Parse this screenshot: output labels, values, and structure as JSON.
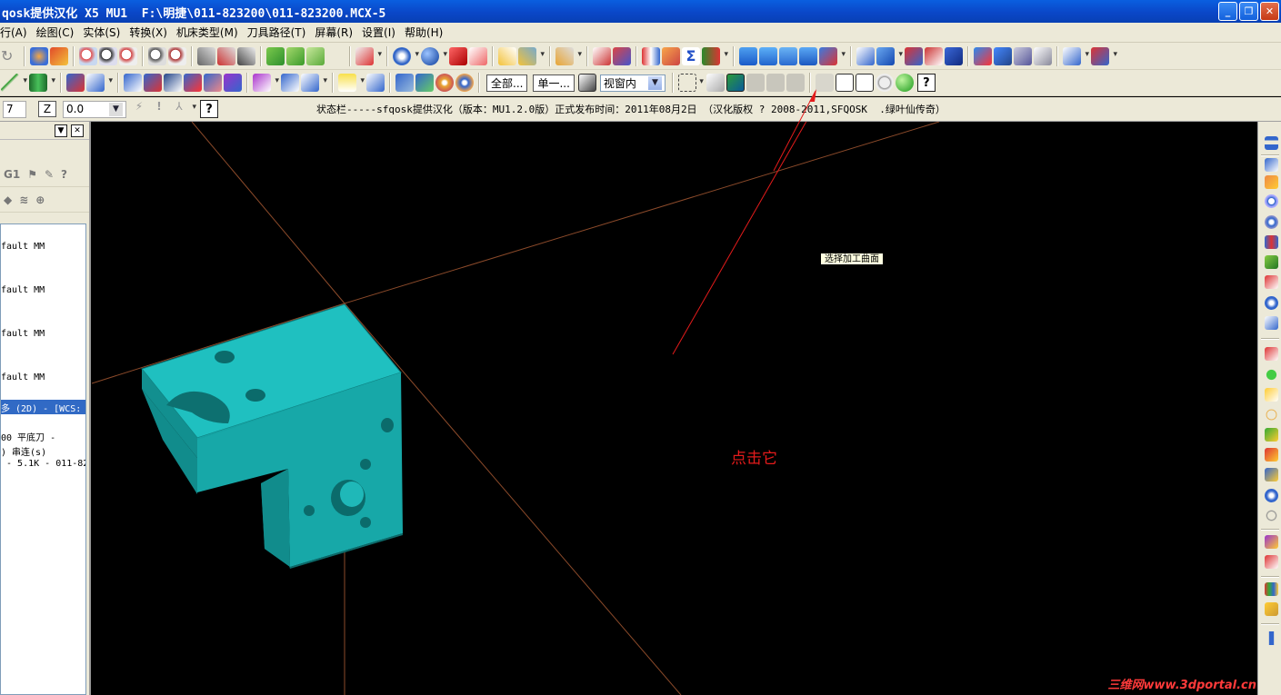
{
  "window": {
    "title": "qosk提供汉化 X5 MU1  F:\\明捷\\011-823200\\011-823200.MCX-5",
    "min": "_",
    "max": "❐",
    "close": "✕"
  },
  "menu": [
    "行(A)",
    "绘图(C)",
    "实体(S)",
    "转换(X)",
    "机床类型(M)",
    "刀具路径(T)",
    "屏幕(R)",
    "设置(I)",
    "帮助(H)"
  ],
  "toolbar2": {
    "all_button": "全部...",
    "single_button": "单一...",
    "view_combo": "视窗内"
  },
  "toolbar3": {
    "left_combo": "7",
    "z_label": "Z",
    "z_value": "0.0",
    "help": "?",
    "status": "状态栏-----sfqosk提供汉化（版本：MU1.2.0版）正式发布时间：2011年08月2日 （汉化版权 ? 2008-2011,SFQOSK  .绿叶仙传奇）"
  },
  "left_panel": {
    "row1_text": "G1",
    "tree": [
      "fault MM",
      "fault MM",
      "fault MM",
      "fault MM",
      "多 (2D) - [WCS:",
      "00 平底刀 -",
      ") 串连(s)",
      " - 5.1K - 011-82"
    ]
  },
  "viewport": {
    "tooltip": "选择加工曲面",
    "annotation": "点击它",
    "watermark": "三维网www.3dportal.cn"
  },
  "colors": {
    "part": "#15a3a3",
    "axis": "#8b4a2a",
    "annotation": "#e41b1b"
  }
}
